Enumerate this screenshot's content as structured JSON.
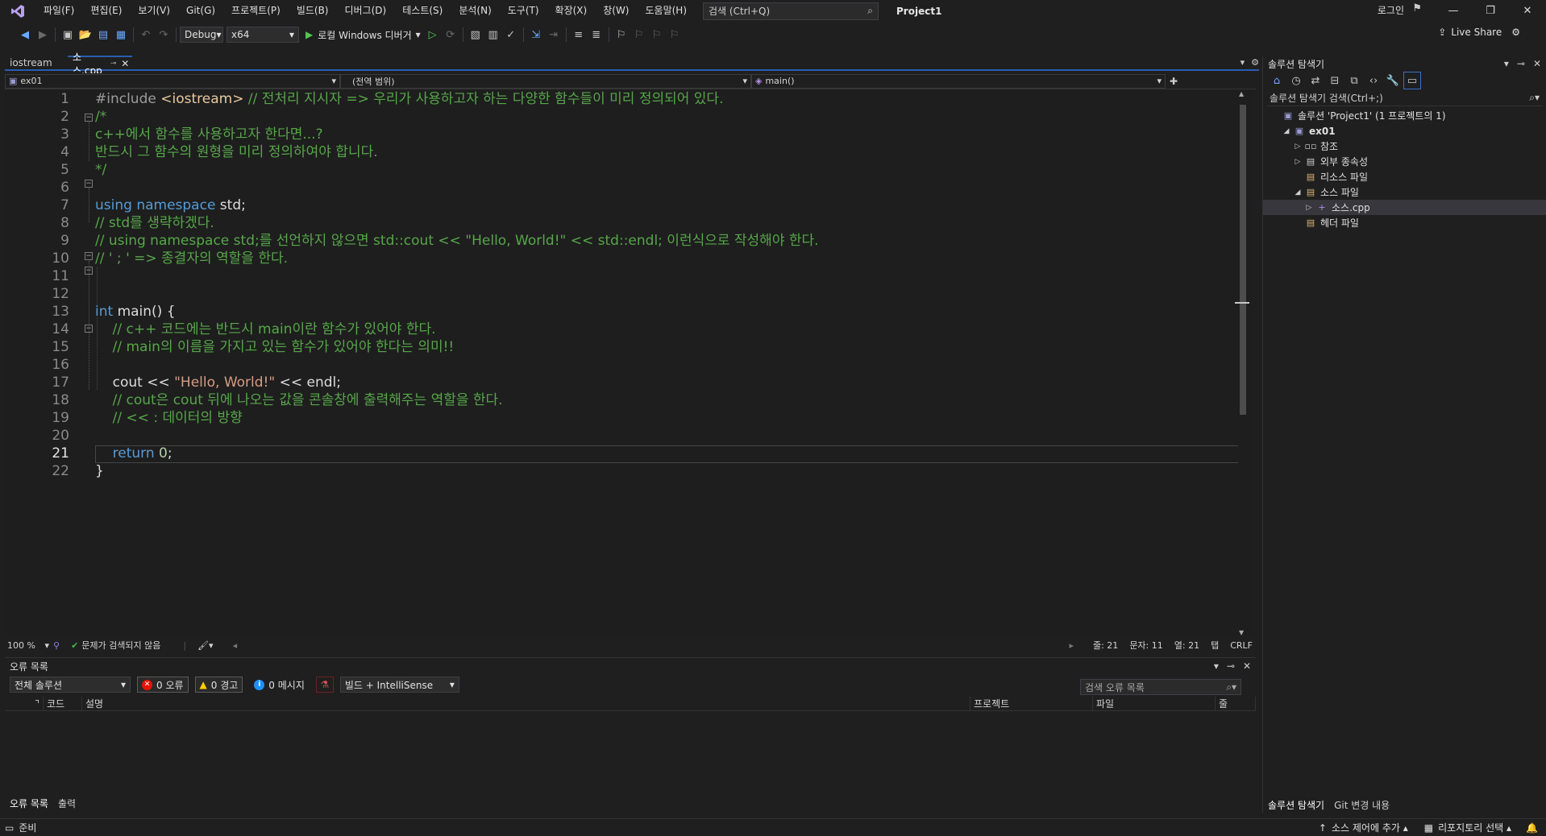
{
  "menubar": {
    "items": [
      "파일(F)",
      "편집(E)",
      "보기(V)",
      "Git(G)",
      "프로젝트(P)",
      "빌드(B)",
      "디버그(D)",
      "테스트(S)",
      "분석(N)",
      "도구(T)",
      "확장(X)",
      "창(W)",
      "도움말(H)"
    ],
    "search_placeholder": "검색 (Ctrl+Q)",
    "project_title": "Project1",
    "login": "로그인"
  },
  "toolbar": {
    "config": "Debug",
    "platform": "x64",
    "run_label": "로컬 Windows 디버거",
    "live_share": "Live Share"
  },
  "tabs": [
    {
      "label": "iostream",
      "active": false
    },
    {
      "label": "소스.cpp",
      "active": true
    }
  ],
  "navbar": {
    "project": "ex01",
    "scope": "(전역 범위)",
    "member": "main()"
  },
  "editor": {
    "current_line": 21,
    "lines": [
      [
        [
          "pre",
          "#include "
        ],
        [
          "inc",
          "<iostream>"
        ],
        [
          "com",
          " // 전처리 지시자 => 우리가 사용하고자 하는 다양한 함수들이 미리 정의되어 있다."
        ]
      ],
      [
        [
          "com",
          "/*"
        ]
      ],
      [
        [
          "com",
          "c++에서 함수를 사용하고자 한다면...?"
        ]
      ],
      [
        [
          "com",
          "반드시 그 함수의 원형을 미리 정의하여야 합니다."
        ]
      ],
      [
        [
          "com",
          "*/"
        ]
      ],
      [],
      [
        [
          "kw",
          "using namespace"
        ],
        [
          "plain",
          " std;"
        ]
      ],
      [
        [
          "com",
          "// std를 생략하겠다."
        ]
      ],
      [
        [
          "com",
          "// using namespace std;를 선언하지 않으면 std::cout << \"Hello, World!\" << std::endl; 이런식으로 작성해야 한다."
        ]
      ],
      [
        [
          "com",
          "// ' ; ' => 종결자의 역할을 한다."
        ]
      ],
      [],
      [],
      [
        [
          "kw",
          "int"
        ],
        [
          "plain",
          " main() {"
        ]
      ],
      [
        [
          "plain",
          "    "
        ],
        [
          "com",
          "// c++ 코드에는 반드시 main이란 함수가 있어야 한다."
        ]
      ],
      [
        [
          "plain",
          "    "
        ],
        [
          "com",
          "// main의 이름을 가지고 있는 함수가 있어야 한다는 의미!!"
        ]
      ],
      [],
      [
        [
          "plain",
          "    cout << "
        ],
        [
          "str",
          "\"Hello, World!\""
        ],
        [
          "plain",
          " << endl;"
        ]
      ],
      [
        [
          "plain",
          "    "
        ],
        [
          "com",
          "// cout은 cout 뒤에 나오는 값을 콘솔창에 출력해주는 역할을 한다."
        ]
      ],
      [
        [
          "plain",
          "    "
        ],
        [
          "com",
          "// << : 데이터의 방향"
        ]
      ],
      [],
      [
        [
          "plain",
          "    "
        ],
        [
          "kw",
          "return"
        ],
        [
          "plain",
          " "
        ],
        [
          "num",
          "0"
        ],
        [
          "plain",
          ";"
        ]
      ],
      [
        [
          "plain",
          "}"
        ]
      ]
    ]
  },
  "editor_status": {
    "zoom": "100 %",
    "issues": "문제가 검색되지 않음",
    "line": "줄: 21",
    "char": "문자: 11",
    "col": "열: 21",
    "tab": "탭",
    "eol": "CRLF"
  },
  "error_list": {
    "title": "오류 목록",
    "scope": "전체 솔루션",
    "errors": "0 오류",
    "warnings": "0 경고",
    "messages": "0 메시지",
    "build_filter": "빌드 + IntelliSense",
    "search_placeholder": "검색 오류 목록",
    "columns": [
      "코드",
      "설명",
      "프로젝트",
      "파일",
      "줄"
    ],
    "bottom_tabs": [
      "오류 목록",
      "출력"
    ]
  },
  "solution_explorer": {
    "title": "솔루션 탐색기",
    "search_placeholder": "솔루션 탐색기 검색(Ctrl+;)",
    "tree": [
      {
        "label": "솔루션 'Project1' (1 프로젝트의 1)",
        "depth": 0,
        "twisty": "",
        "icon": "solution-icon",
        "selected": false
      },
      {
        "label": "ex01",
        "depth": 1,
        "twisty": "open",
        "icon": "project-icon",
        "selected": false
      },
      {
        "label": "참조",
        "depth": 2,
        "twisty": "closed",
        "icon": "references-icon",
        "selected": false
      },
      {
        "label": "외부 종속성",
        "depth": 2,
        "twisty": "closed",
        "icon": "external-deps-icon",
        "selected": false
      },
      {
        "label": "리소스 파일",
        "depth": 2,
        "twisty": "",
        "icon": "folder-filter-icon",
        "selected": false
      },
      {
        "label": "소스 파일",
        "depth": 2,
        "twisty": "open",
        "icon": "folder-filter-icon",
        "selected": false
      },
      {
        "label": "소스.cpp",
        "depth": 3,
        "twisty": "closed",
        "icon": "cpp-file-icon",
        "selected": true
      },
      {
        "label": "헤더 파일",
        "depth": 2,
        "twisty": "",
        "icon": "folder-filter-icon",
        "selected": false
      }
    ],
    "bottom_tabs": [
      "솔루션 탐색기",
      "Git 변경 내용"
    ]
  },
  "statusbar": {
    "ready": "준비",
    "source_control": "소스 제어에 추가",
    "repository": "리포지토리 선택"
  },
  "colors": {
    "accent": "#2a5db0",
    "comment": "#57a64a",
    "keyword": "#569cd6",
    "string": "#d69d85"
  }
}
